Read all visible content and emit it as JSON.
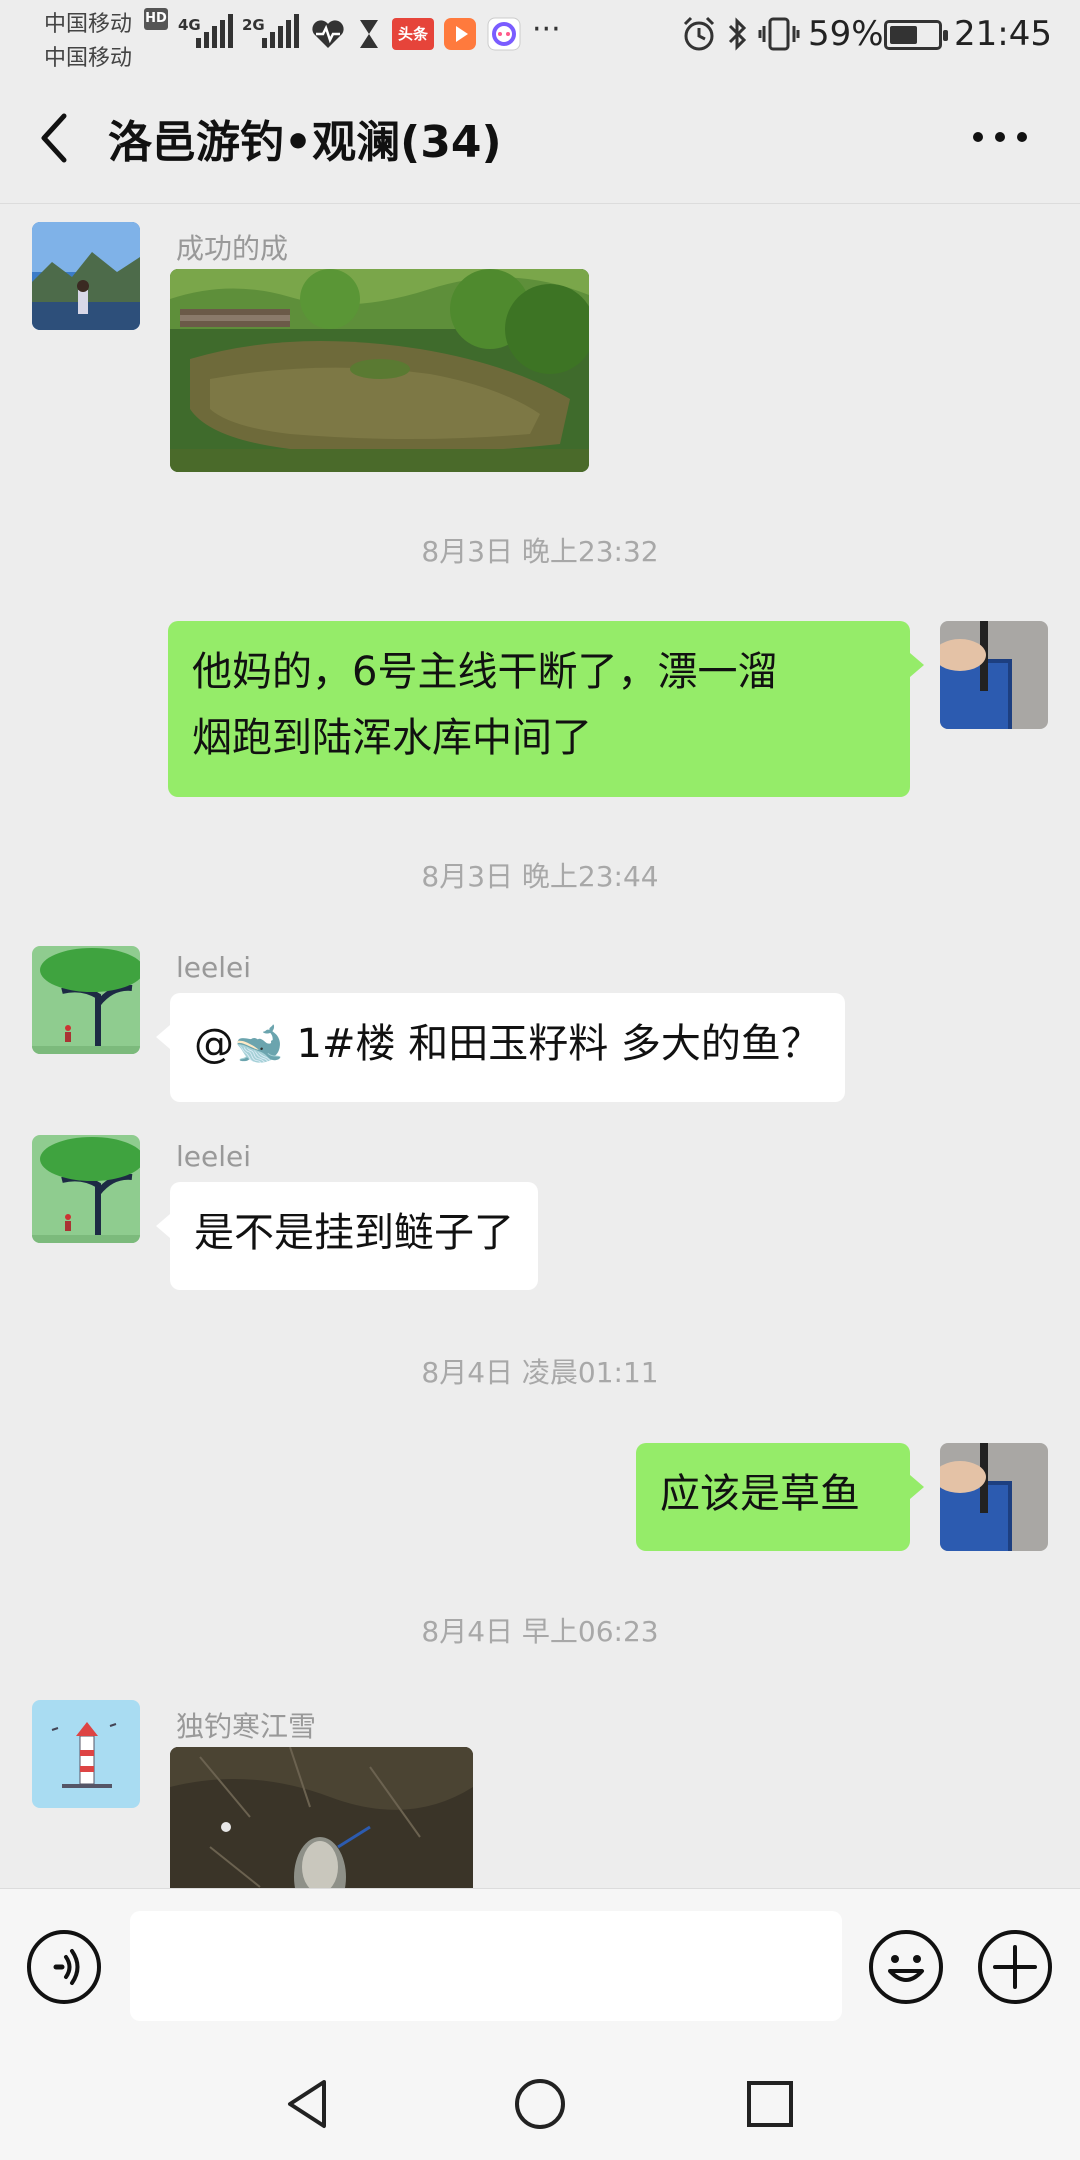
{
  "status_bar": {
    "carrier_1": "中国移动",
    "carrier_2": "中国移动",
    "hd_badge": "HD",
    "network_1": "4G",
    "network_2": "2G",
    "app_badge_toutiao": "头条",
    "overflow": "···",
    "battery": "59%",
    "time": "21:45",
    "battery_level": 0.59
  },
  "header": {
    "title": "洛邑游钓•观澜(34)"
  },
  "messages": [
    {
      "sender": "成功的成"
    },
    {
      "timestamp": "8月3日 晚上23:32"
    },
    {
      "text": "他妈的，6号主线干断了，漂一溜\n烟跑到陆浑水库中间了"
    },
    {
      "timestamp": "8月3日 晚上23:44"
    },
    {
      "sender": "leelei",
      "text": "@🐋 1#楼 和田玉籽料  多大的鱼？"
    },
    {
      "sender": "leelei",
      "text": "是不是挂到鲢子了"
    },
    {
      "timestamp": "8月4日 凌晨01:11"
    },
    {
      "text": "应该是草鱼"
    },
    {
      "timestamp": "8月4日 早上06:23"
    },
    {
      "sender": "独钓寒江雪"
    }
  ],
  "colors": {
    "background": "#ededed",
    "bubble_sent": "#95ec69",
    "bubble_received": "#ffffff",
    "timestamp": "#a8a8a8"
  }
}
